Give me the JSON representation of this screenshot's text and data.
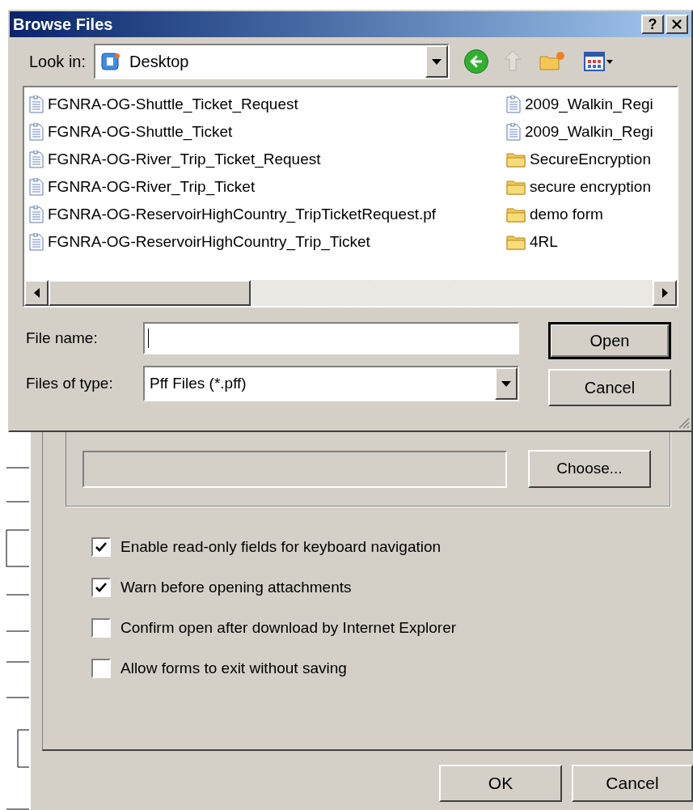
{
  "browse_dialog": {
    "title": "Browse Files",
    "help_button": "?",
    "look_in": {
      "label": "Look in:",
      "value": "Desktop"
    },
    "file_columns": [
      [
        {
          "name": "FGNRA-OG-Shuttle_Ticket_Request",
          "kind": "file"
        },
        {
          "name": "FGNRA-OG-Shuttle_Ticket",
          "kind": "file"
        },
        {
          "name": "FGNRA-OG-River_Trip_Ticket_Request",
          "kind": "file"
        },
        {
          "name": "FGNRA-OG-River_Trip_Ticket",
          "kind": "file"
        },
        {
          "name": "FGNRA-OG-ReservoirHighCountry_TripTicketRequest.pf",
          "kind": "file"
        },
        {
          "name": "FGNRA-OG-ReservoirHighCountry_Trip_Ticket",
          "kind": "file"
        }
      ],
      [
        {
          "name": "2009_Walkin_Regi",
          "kind": "file"
        },
        {
          "name": "2009_Walkin_Regi",
          "kind": "file"
        },
        {
          "name": "SecureEncryption",
          "kind": "folder"
        },
        {
          "name": "secure encryption",
          "kind": "folder"
        },
        {
          "name": "demo form",
          "kind": "folder"
        },
        {
          "name": "4RL",
          "kind": "folder"
        }
      ]
    ],
    "file_name": {
      "label": "File name:"
    },
    "file_type": {
      "label": "Files of type:",
      "value": "Pff Files (*.pff)"
    },
    "buttons": [
      {
        "label": "Open",
        "default": true
      },
      {
        "label": "Cancel",
        "default": false
      }
    ]
  },
  "options_dialog": {
    "choose_button": "Choose...",
    "options": [
      {
        "label": "Enable read-only fields for keyboard navigation",
        "checked": true
      },
      {
        "label": "Warn before opening attachments",
        "checked": true
      },
      {
        "label": "Confirm open after download by Internet Explorer",
        "checked": false
      },
      {
        "label": "Allow forms to exit without saving",
        "checked": false
      }
    ],
    "buttons": [
      {
        "label": "OK"
      },
      {
        "label": "Cancel"
      }
    ]
  }
}
